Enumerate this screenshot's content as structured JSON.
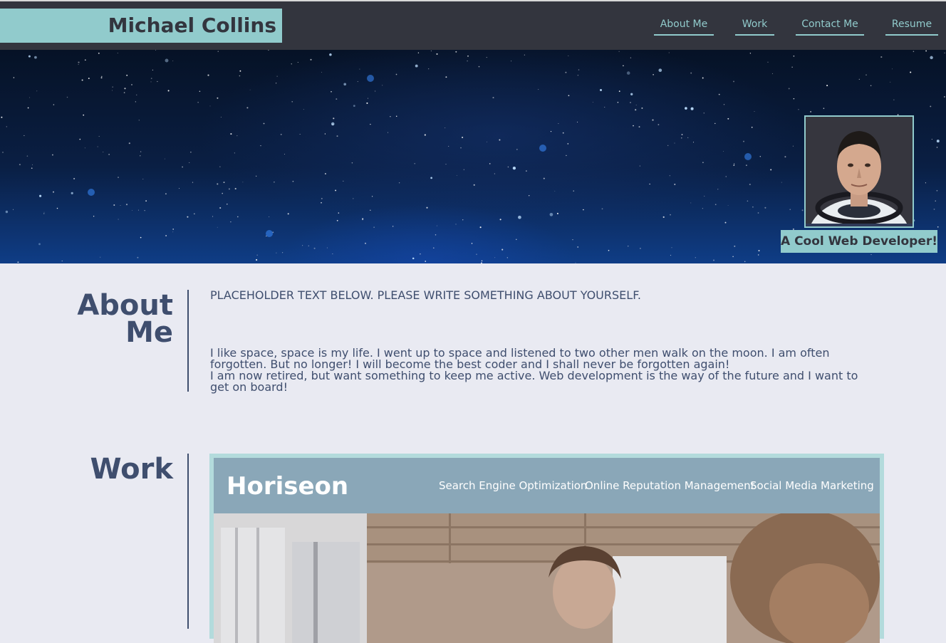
{
  "header": {
    "name": "Michael Collins",
    "nav": [
      {
        "label": "About Me"
      },
      {
        "label": "Work"
      },
      {
        "label": "Contact Me"
      },
      {
        "label": "Resume"
      }
    ]
  },
  "hero": {
    "tagline": "A Cool Web Developer!"
  },
  "about": {
    "title_line1": "About",
    "title_line2": "Me",
    "placeholder": "PLACEHOLDER TEXT BELOW. PLEASE WRITE SOMETHING ABOUT YOURSELF.",
    "body_lines": [
      "I like space, space is my life. I went up to space and listened to two other men walk on the moon. I am often",
      "forgotten. But no longer! I will become the best coder and I shall never be forgotten again!",
      "I am now retired, but want something to keep me active. Web development is the way of the future and I want to",
      "get on board!"
    ]
  },
  "work": {
    "title": "Work",
    "project": {
      "logo": "Horiseon",
      "nav": [
        "Search Engine Optimization",
        "Online Reputation Management",
        "Social Media Marketing"
      ]
    }
  },
  "colors": {
    "accent": "#91cbcc",
    "header_bg": "#33353e",
    "page_bg": "#e9eaf2",
    "heading": "#3f4e6e"
  },
  "icons": {
    "avatar": "astronaut-portrait"
  }
}
